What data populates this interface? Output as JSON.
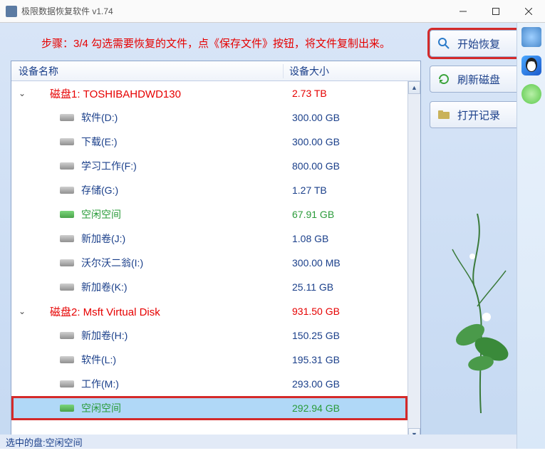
{
  "titlebar": {
    "title": "极限数据恢复软件 v1.74"
  },
  "instruction": "步骤：3/4 勾选需要恢复的文件，点《保存文件》按钮，将文件复制出来。",
  "headers": {
    "name": "设备名称",
    "size": "设备大小"
  },
  "disks": [
    {
      "label": "磁盘1: TOSHIBAHDWD130",
      "size": "2.73 TB",
      "expanded": true,
      "partitions": [
        {
          "label": "软件(D:)",
          "size": "300.00 GB",
          "type": "part"
        },
        {
          "label": "下载(E:)",
          "size": "300.00 GB",
          "type": "part"
        },
        {
          "label": "学习工作(F:)",
          "size": "800.00 GB",
          "type": "part"
        },
        {
          "label": "存储(G:)",
          "size": "1.27 TB",
          "type": "part"
        },
        {
          "label": "空闲空间",
          "size": "67.91 GB",
          "type": "free"
        },
        {
          "label": "新加卷(J:)",
          "size": "1.08 GB",
          "type": "part"
        },
        {
          "label": "沃尔沃二翁(I:)",
          "size": "300.00 MB",
          "type": "part"
        },
        {
          "label": "新加卷(K:)",
          "size": "25.11 GB",
          "type": "part"
        }
      ]
    },
    {
      "label": "磁盘2: Msft     Virtual Disk",
      "size": "931.50 GB",
      "expanded": true,
      "partitions": [
        {
          "label": "新加卷(H:)",
          "size": "150.25 GB",
          "type": "part"
        },
        {
          "label": "软件(L:)",
          "size": "195.31 GB",
          "type": "part"
        },
        {
          "label": "工作(M:)",
          "size": "293.00 GB",
          "type": "part"
        },
        {
          "label": "空闲空间",
          "size": "292.94 GB",
          "type": "free",
          "selected": true
        }
      ]
    }
  ],
  "actions": {
    "start_recovery": "开始恢复",
    "refresh_disk": "刷新磁盘",
    "open_log": "打开记录"
  },
  "status": "选中的盘:空闲空间"
}
